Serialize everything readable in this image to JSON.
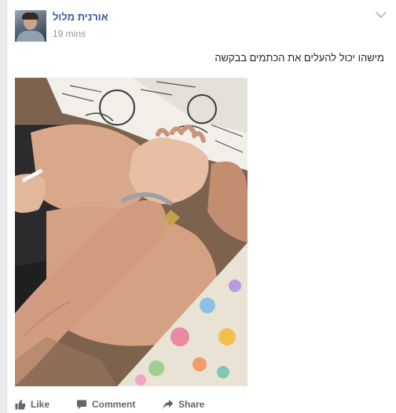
{
  "post": {
    "author": "אורנית מלול",
    "timestamp": "19 mins",
    "text": "מישהו יכול להעלים את הכתמים בבקשה"
  },
  "actions": {
    "like": "Like",
    "comment": "Comment",
    "share": "Share"
  },
  "colors": {
    "link": "#365899",
    "meta": "#90949c",
    "action": "#606770",
    "background": "#e9ebee"
  },
  "icons": [
    "chevron-down-icon",
    "like-icon",
    "comment-icon",
    "share-icon"
  ]
}
